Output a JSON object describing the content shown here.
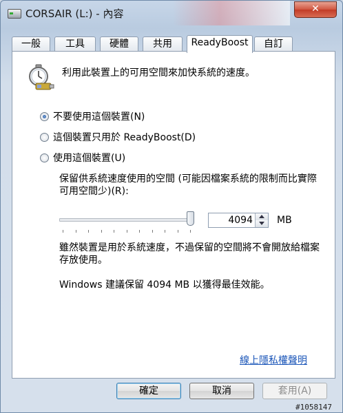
{
  "window": {
    "title": "CORSAIR (L:) - 內容",
    "close_label": "✕"
  },
  "tabs": [
    {
      "label": "一般",
      "active": false
    },
    {
      "label": "工具",
      "active": false
    },
    {
      "label": "硬體",
      "active": false
    },
    {
      "label": "共用",
      "active": false
    },
    {
      "label": "ReadyBoost",
      "active": true
    },
    {
      "label": "自訂",
      "active": false
    }
  ],
  "readyboost": {
    "icon": "stopwatch-usb-icon",
    "description": "利用此裝置上的可用空間來加快系統的速度。",
    "options": [
      {
        "label": "不要使用這個裝置(N)",
        "checked": true
      },
      {
        "label": "這個裝置只用於 ReadyBoost(D)",
        "checked": false
      },
      {
        "label": "使用這個裝置(U)",
        "checked": false
      }
    ],
    "reserve_label": "保留供系統速度使用的空間 (可能因檔案系統的限制而比實際可用空間少)(R):",
    "slider_level": 1.0,
    "reserve_value": "4094",
    "unit": "MB",
    "note": "雖然裝置是用於系統速度，不過保留的空間將不會開放給檔案存放使用。",
    "recommendation": "Windows 建議保留 4094 MB 以獲得最佳效能。",
    "privacy_link": "線上隱私權聲明"
  },
  "buttons": {
    "ok": "確定",
    "cancel": "取消",
    "apply": "套用(A)"
  },
  "watermark": "#1058147"
}
